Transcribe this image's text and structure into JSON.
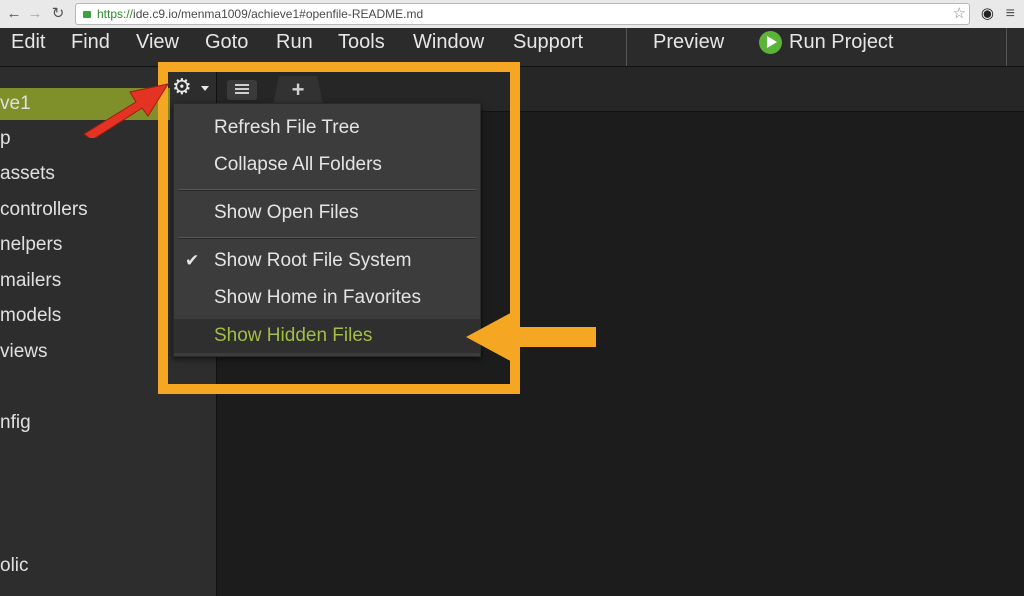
{
  "browser": {
    "url_scheme": "https://",
    "url_rest": "ide.c9.io/menma1009/achieve1#openfile-README.md",
    "icons": {
      "back": "back-arrow-icon",
      "forward": "forward-arrow-icon",
      "reload": "reload-icon",
      "bookmark": "star-icon",
      "extension": "extension-icon",
      "menu": "hamburger-menu-icon"
    }
  },
  "menubar": {
    "items": [
      "Edit",
      "Find",
      "View",
      "Goto",
      "Run",
      "Tools",
      "Window",
      "Support"
    ],
    "preview": "Preview",
    "run_project": "Run Project"
  },
  "sidebar": {
    "items": [
      {
        "label": "ve1",
        "selected": true
      },
      {
        "label": "p"
      },
      {
        "label": "assets"
      },
      {
        "label": "controllers"
      },
      {
        "label": "nelpers"
      },
      {
        "label": "mailers"
      },
      {
        "label": "models"
      },
      {
        "label": "views"
      },
      {
        "label": ""
      },
      {
        "label": "nfig"
      },
      {
        "label": "olic"
      }
    ]
  },
  "toolbar": {
    "gear_icon": "gear-icon",
    "add_tab": "+"
  },
  "dropdown": {
    "items": [
      {
        "label": "Refresh File Tree"
      },
      {
        "label": "Collapse All Folders"
      },
      {
        "label": "Show Open Files"
      },
      {
        "label": "Show Root File System",
        "checked": true
      },
      {
        "label": "Show Home in Favorites"
      },
      {
        "label": "Show Hidden Files",
        "highlighted": true
      }
    ]
  },
  "colors": {
    "highlight_orange": "#f5a623",
    "annotation_red": "#e53323",
    "selected_green": "#7f8f2a",
    "hover_text": "#a3bd45",
    "run_green": "#5cb339"
  }
}
